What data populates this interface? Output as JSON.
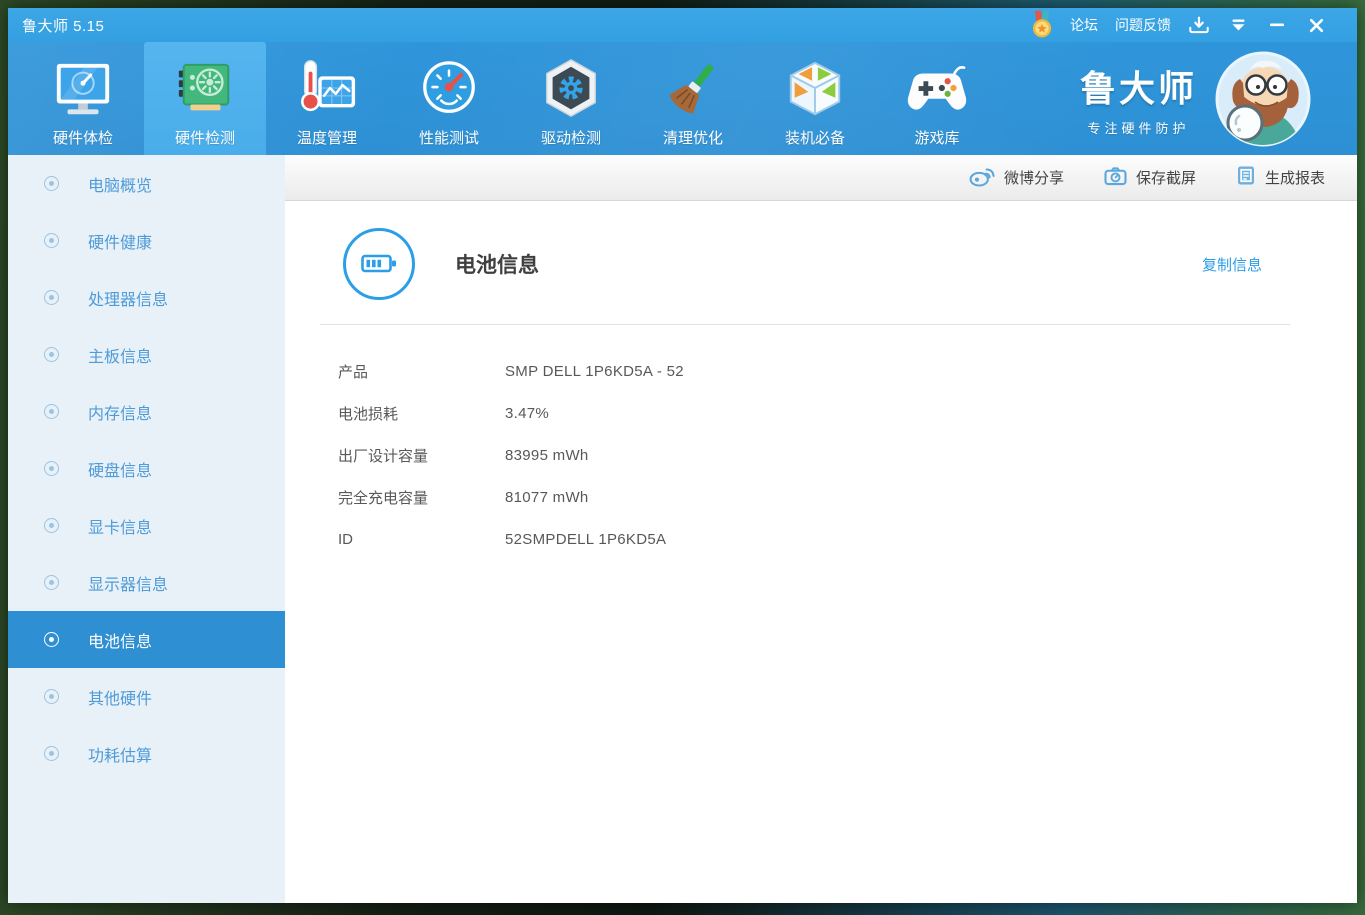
{
  "colors": {
    "accent": "#2b9ee8",
    "titlebar_blue": "#38a2e3",
    "toolbar_blue": "#2e90d4",
    "sidebar_bg": "#e8f1f8",
    "sidebar_selected": "#2e8fd3",
    "link_blue": "#2b9ee8"
  },
  "titlebar": {
    "app_title": "鲁大师 5.15",
    "forum": "论坛",
    "feedback": "问题反馈",
    "icons": [
      "medal-icon",
      "download-icon",
      "dropdown-caret-icon",
      "minimize-icon",
      "close-icon"
    ]
  },
  "toolbar": {
    "active_item": "硬件检测",
    "items": [
      {
        "label": "硬件体检",
        "icon": "monitor-gauge-icon"
      },
      {
        "label": "硬件检测",
        "icon": "gpu-card-icon"
      },
      {
        "label": "温度管理",
        "icon": "thermometer-chart-icon"
      },
      {
        "label": "性能测试",
        "icon": "speedometer-icon"
      },
      {
        "label": "驱动检测",
        "icon": "hexagon-gear-icon"
      },
      {
        "label": "清理优化",
        "icon": "broom-icon"
      },
      {
        "label": "装机必备",
        "icon": "cube-icon"
      },
      {
        "label": "游戏库",
        "icon": "gamepad-icon"
      }
    ],
    "brand": {
      "name": "鲁大师",
      "tagline": "专注硬件防护",
      "icon": "mascot-avatar"
    }
  },
  "sidebar": {
    "active_item": "电池信息",
    "items": [
      {
        "label": "电脑概览"
      },
      {
        "label": "硬件健康"
      },
      {
        "label": "处理器信息"
      },
      {
        "label": "主板信息"
      },
      {
        "label": "内存信息"
      },
      {
        "label": "硬盘信息"
      },
      {
        "label": "显卡信息"
      },
      {
        "label": "显示器信息"
      },
      {
        "label": "电池信息"
      },
      {
        "label": "其他硬件"
      },
      {
        "label": "功耗估算"
      }
    ]
  },
  "actions": {
    "weibo_share": "微博分享",
    "save_screenshot": "保存截屏",
    "generate_report": "生成报表"
  },
  "content": {
    "title": "电池信息",
    "title_icon": "battery-icon",
    "copy_link": "复制信息",
    "fields": [
      {
        "label": "产品",
        "value": "SMP DELL 1P6KD5A - 52"
      },
      {
        "label": "电池损耗",
        "value": "3.47%"
      },
      {
        "label": "出厂设计容量",
        "value": "83995 mWh"
      },
      {
        "label": "完全充电容量",
        "value": "81077 mWh"
      },
      {
        "label": "ID",
        "value": "52SMPDELL 1P6KD5A"
      }
    ]
  }
}
